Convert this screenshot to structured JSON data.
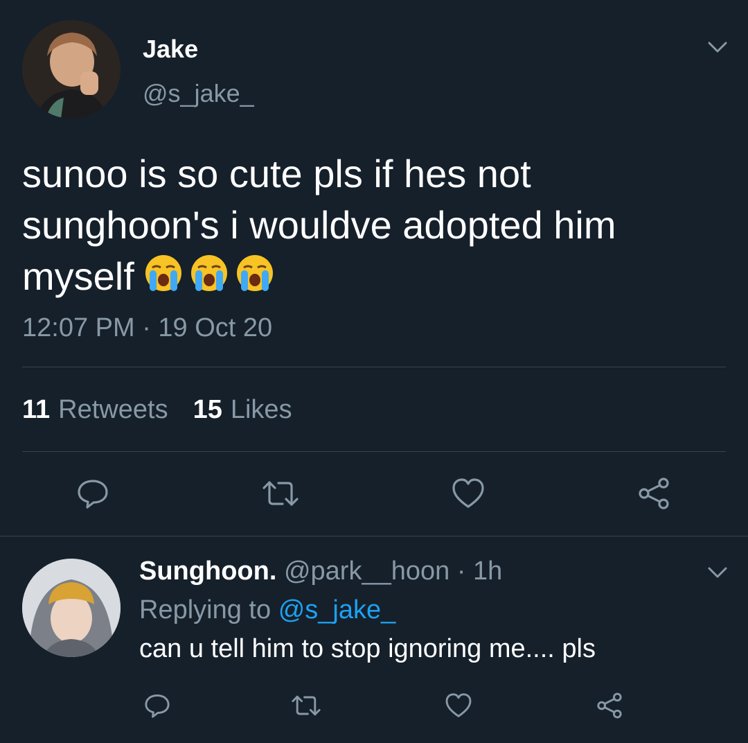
{
  "tweet": {
    "author_name": "Jake",
    "author_handle": "@s_jake_",
    "text": "sunoo is so cute pls if hes not sunghoon's i wouldve adopted him myself",
    "emojis": [
      "loudly-crying-face",
      "loudly-crying-face",
      "loudly-crying-face"
    ],
    "time": "12:07 PM · 19 Oct 20",
    "retweets_count": "11",
    "retweets_label": "Retweets",
    "likes_count": "15",
    "likes_label": "Likes"
  },
  "reply": {
    "author_name": "Sunghoon.",
    "author_handle": "@park__hoon",
    "separator": " · ",
    "age": "1h",
    "replying_label": "Replying to",
    "replying_to": "@s_jake_",
    "text": "can u tell him to stop ignoring me.... pls"
  },
  "icons": [
    "comment-icon",
    "retweet-icon",
    "like-icon",
    "share-icon",
    "chevron-down-icon"
  ],
  "colors": {
    "background": "#15202b",
    "secondary_text": "#8899a6",
    "link": "#1da1f2",
    "divider": "#38444d"
  }
}
